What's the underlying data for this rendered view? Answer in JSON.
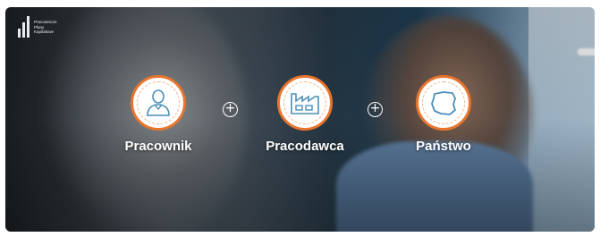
{
  "logo": {
    "lines": [
      "Pracownicze",
      "Plany",
      "Kapitałowe"
    ]
  },
  "items": [
    {
      "label": "Pracownik",
      "icon": "person-icon"
    },
    {
      "label": "Pracodawca",
      "icon": "factory-icon"
    },
    {
      "label": "Państwo",
      "icon": "map-poland-icon"
    }
  ],
  "separators": [
    "+",
    "+"
  ],
  "colors": {
    "accent": "#e8752d",
    "icon_stroke": "#4a8fb8"
  }
}
